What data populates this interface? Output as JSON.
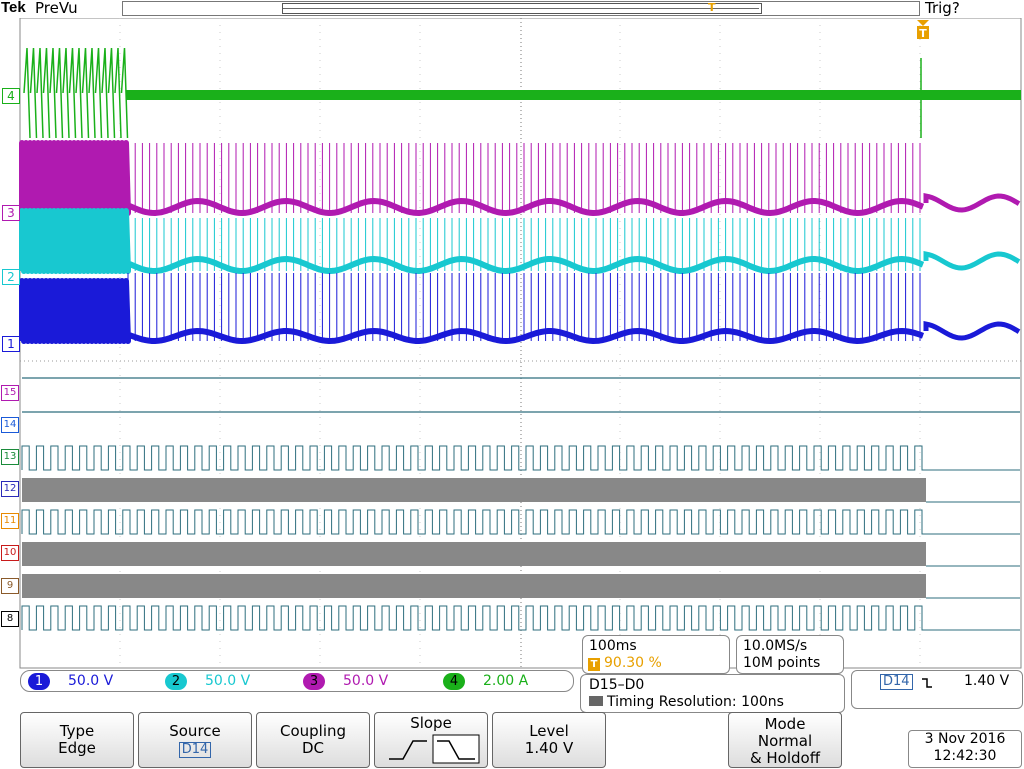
{
  "header": {
    "brand": "Tek",
    "acquisition_state": "PreVu",
    "trigger_status": "Trig?"
  },
  "channel_markers": {
    "ch4": "4",
    "ch3": "3",
    "ch2": "2",
    "ch1": "1",
    "d15": "15",
    "d14": "14",
    "d13": "13",
    "d12": "12",
    "d11": "11",
    "d10": "10",
    "d9": "9",
    "d8": "8"
  },
  "channels": [
    {
      "num": "1",
      "scale": "50.0 V",
      "color": "#1a1ad8"
    },
    {
      "num": "2",
      "scale": "50.0 V",
      "color": "#18c8d0"
    },
    {
      "num": "3",
      "scale": "50.0 V",
      "color": "#b01ab0"
    },
    {
      "num": "4",
      "scale": "2.00 A",
      "color": "#1ab01a"
    }
  ],
  "timebase": {
    "time_per_div": "100ms",
    "trigger_position": "90.30 %",
    "sample_rate": "10.0MS/s",
    "record_length": "10M points"
  },
  "digital": {
    "range": "D15–D0",
    "timing_resolution": "Timing Resolution: 100ns"
  },
  "trigger_readout": {
    "source": "D14",
    "slope_symbol": "⌐",
    "level": "1.40 V"
  },
  "buttons": {
    "type_label": "Type",
    "type_value": "Edge",
    "source_label": "Source",
    "source_value": "D14",
    "coupling_label": "Coupling",
    "coupling_value": "DC",
    "slope_label": "Slope",
    "level_label": "Level",
    "level_value": "1.40 V",
    "mode_label": "Mode",
    "mode_value1": "Normal",
    "mode_value2": "& Holdoff"
  },
  "datetime": {
    "date": "3 Nov 2016",
    "time": "12:42:30"
  },
  "colors": {
    "ch1": "#1a1ad8",
    "ch2": "#18c8d0",
    "ch3": "#b01ab0",
    "ch4": "#1ab01a",
    "digital": "#2e6e7e",
    "trigger": "#e8a000"
  }
}
